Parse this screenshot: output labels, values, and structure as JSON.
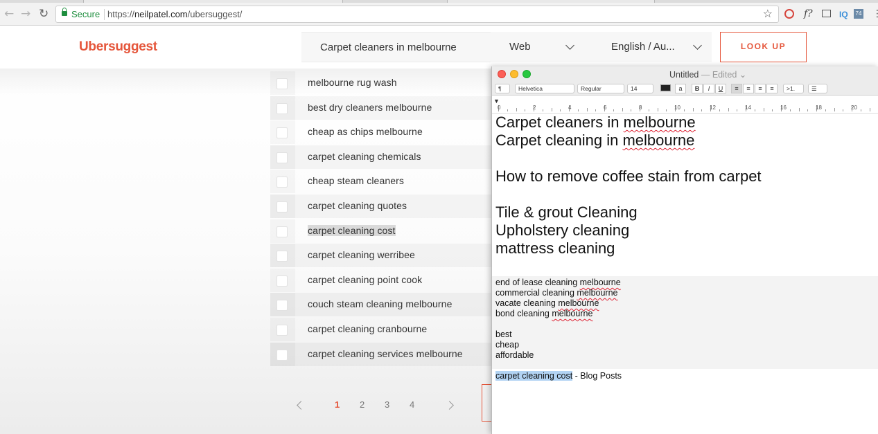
{
  "browser": {
    "secure_label": "Secure",
    "url_prefix": "https://",
    "url_host": "neilpatel.com",
    "url_path": "/ubersuggest/",
    "extension_74": "74",
    "extension_iq": "IQ",
    "extension_fx": "f?"
  },
  "header": {
    "logo": "Ubersuggest",
    "keyword_value": "Carpet cleaners in melbourne",
    "source_value": "Web",
    "language_value": "English / Au...",
    "lookup_label": "LOOK UP"
  },
  "results": [
    {
      "keyword": "melbourne rug wash"
    },
    {
      "keyword": "best dry cleaners melbourne"
    },
    {
      "keyword": "cheap as chips melbourne"
    },
    {
      "keyword": "carpet cleaning chemicals"
    },
    {
      "keyword": "cheap steam cleaners"
    },
    {
      "keyword": "carpet cleaning quotes"
    },
    {
      "keyword": "carpet cleaning cost"
    },
    {
      "keyword": "carpet cleaning werribee"
    },
    {
      "keyword": "carpet cleaning point cook"
    },
    {
      "keyword": "couch steam cleaning melbourne"
    },
    {
      "keyword": "carpet cleaning cranbourne"
    },
    {
      "keyword": "carpet cleaning services melbourne"
    }
  ],
  "pagination": {
    "pages": [
      "1",
      "2",
      "3",
      "4"
    ],
    "current": "1"
  },
  "textedit": {
    "title": "Untitled",
    "status": "— Edited",
    "paragraph_style": "¶",
    "font": "Helvetica",
    "typeface": "Regular",
    "size": "14",
    "text_color_btn": "a",
    "bold": "B",
    "italic": "I",
    "underline": "U",
    "spacing": ">1.",
    "ruler_numbers": [
      "0",
      "2",
      "4",
      "6",
      "8",
      "10",
      "12",
      "14",
      "16",
      "18",
      "20"
    ],
    "lines": {
      "l1a": "Carpet cleaners in ",
      "l1b": "melbourne",
      "l2a": "Carpet cleaning in ",
      "l2b": "melbourne",
      "l3": "How to remove coffee stain from carpet",
      "l4": "Tile & grout Cleaning",
      "l5": "Upholstery cleaning",
      "l6": "mattress cleaning",
      "s1a": "end of lease cleaning ",
      "s1b": "melbourne",
      "s2a": "commercial cleaning ",
      "s2b": "melbourne",
      "s3a": "vacate cleaning ",
      "s3b": "melbourne",
      "s4a": "bond cleaning ",
      "s4b": "melbourne",
      "s5": "best",
      "s6": "cheap",
      "s7": "affordable",
      "s8a": "carpet cleaning cost",
      "s8b": " - Blog Posts"
    }
  }
}
